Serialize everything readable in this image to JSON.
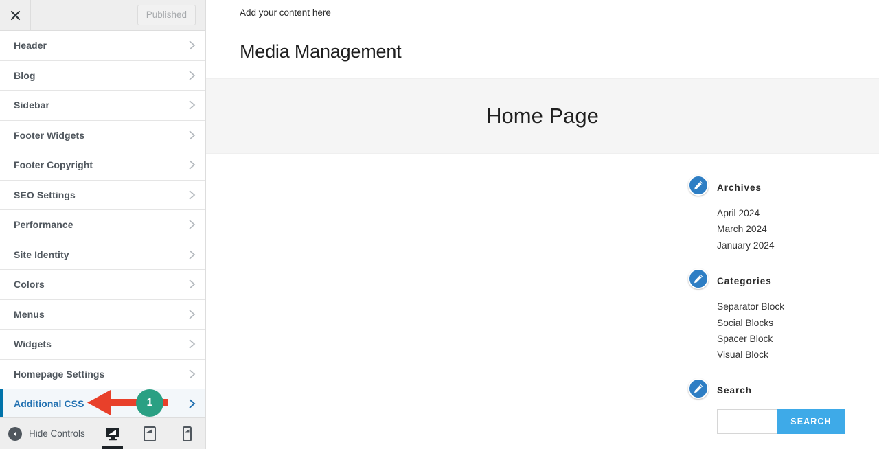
{
  "customizer": {
    "close_label": "×",
    "close_icon": "close-icon",
    "publish_label": "Published",
    "items": [
      {
        "label": "Header",
        "active": false
      },
      {
        "label": "Blog",
        "active": false
      },
      {
        "label": "Sidebar",
        "active": false
      },
      {
        "label": "Footer Widgets",
        "active": false
      },
      {
        "label": "Footer Copyright",
        "active": false
      },
      {
        "label": "SEO Settings",
        "active": false
      },
      {
        "label": "Performance",
        "active": false
      },
      {
        "label": "Site Identity",
        "active": false
      },
      {
        "label": "Colors",
        "active": false
      },
      {
        "label": "Menus",
        "active": false
      },
      {
        "label": "Widgets",
        "active": false
      },
      {
        "label": "Homepage Settings",
        "active": false
      },
      {
        "label": "Additional CSS",
        "active": true
      }
    ],
    "footer": {
      "hide_controls_label": "Hide Controls",
      "hide_controls_icon": "collapse-left-icon",
      "devices": [
        {
          "name": "desktop",
          "icon": "desktop-icon",
          "active": true
        },
        {
          "name": "tablet",
          "icon": "tablet-icon",
          "active": false
        },
        {
          "name": "mobile",
          "icon": "mobile-icon",
          "active": false
        }
      ]
    },
    "accent_color": "#0073aa",
    "active_text_color": "#2271b1"
  },
  "preview": {
    "topbar_text": "Add your content here",
    "site_title": "Media Management",
    "hero_heading": "Home Page",
    "widgets": [
      {
        "title": "Archives",
        "edit_icon": "pencil-edit-icon",
        "items": [
          "April 2024",
          "March 2024",
          "January 2024"
        ]
      },
      {
        "title": "Categories",
        "edit_icon": "pencil-edit-icon",
        "items": [
          "Separator Block",
          "Social Blocks",
          "Spacer Block",
          "Visual Block"
        ]
      }
    ],
    "search_widget": {
      "title": "Search",
      "edit_icon": "pencil-edit-icon",
      "input_value": "",
      "input_placeholder": "",
      "button_label": "SEARCH",
      "button_color": "#3eaae8"
    }
  },
  "annotation": {
    "step_number": "1",
    "arrow_icon": "left-arrow-annotation",
    "arrow_color": "#e8402a",
    "badge_color": "#2aa083"
  }
}
